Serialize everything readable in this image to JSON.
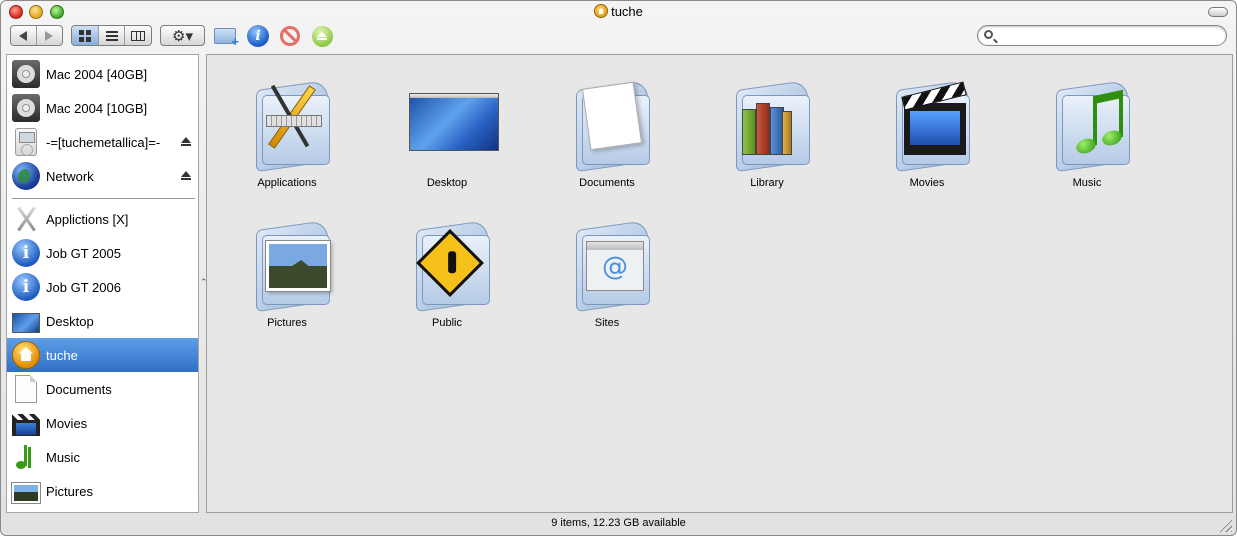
{
  "window": {
    "title": "tuche"
  },
  "toolbar": {
    "search": {
      "value": "",
      "placeholder": ""
    }
  },
  "sidebar": {
    "devices": [
      {
        "label": "Mac 2004 [40GB]",
        "icon": "hard-disk-icon"
      },
      {
        "label": "Mac 2004 [10GB]",
        "icon": "hard-disk-icon"
      },
      {
        "label": "-=[tuchemetallica]=-",
        "icon": "ipod-icon",
        "ejectable": true
      },
      {
        "label": "Network",
        "icon": "network-globe-icon",
        "ejectable": true
      }
    ],
    "places": [
      {
        "label": "Applictions [X]",
        "icon": "applications-icon"
      },
      {
        "label": "Job GT 2005",
        "icon": "info-icon"
      },
      {
        "label": "Job GT 2006",
        "icon": "info-icon"
      },
      {
        "label": "Desktop",
        "icon": "desktop-icon"
      },
      {
        "label": "tuche",
        "icon": "home-icon",
        "selected": true
      },
      {
        "label": "Documents",
        "icon": "document-icon"
      },
      {
        "label": "Movies",
        "icon": "clapperboard-icon"
      },
      {
        "label": "Music",
        "icon": "music-note-icon"
      },
      {
        "label": "Pictures",
        "icon": "picture-icon"
      }
    ]
  },
  "content": {
    "items": [
      {
        "label": "Applications",
        "icon": "applications-folder-icon"
      },
      {
        "label": "Desktop",
        "icon": "desktop-folder-icon"
      },
      {
        "label": "Documents",
        "icon": "documents-folder-icon"
      },
      {
        "label": "Library",
        "icon": "library-folder-icon"
      },
      {
        "label": "Movies",
        "icon": "movies-folder-icon"
      },
      {
        "label": "Music",
        "icon": "music-folder-icon"
      },
      {
        "label": "Pictures",
        "icon": "pictures-folder-icon"
      },
      {
        "label": "Public",
        "icon": "public-folder-icon"
      },
      {
        "label": "Sites",
        "icon": "sites-folder-icon"
      }
    ]
  },
  "status": {
    "text": "9 items, 12.23 GB available"
  },
  "colors": {
    "selection": "#3a7bd5",
    "folder": "#b5cbe6",
    "content_bg": "#e7e7e7"
  }
}
